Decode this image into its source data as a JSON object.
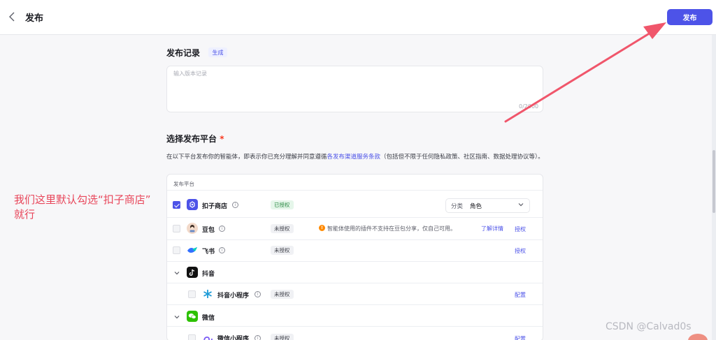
{
  "header": {
    "title": "发布",
    "publish_label": "发布"
  },
  "record": {
    "title": "发布记录",
    "generate_label": "生成",
    "placeholder": "输入版本记录",
    "char_count": "0/2000"
  },
  "platforms": {
    "title": "选择发布平台",
    "required_mark": "*",
    "agreement_prefix": "在以下平台发布你的智能体，即表示你已充分理解并同意遵循",
    "agreement_link": "各发布渠道服务条款",
    "agreement_suffix": "（包括但不限于任何隐私政策、社区指南、数据处理协议等）。",
    "table_header": "发布平台",
    "rows": [
      {
        "name": "扣子商店",
        "status": "已授权",
        "checked": true
      },
      {
        "name": "豆包",
        "status": "未授权",
        "checked": false,
        "warning": "智能体使用的插件不支持在豆包分享，仅自己可用。",
        "warning_link": "了解详情",
        "action": "授权"
      },
      {
        "name": "飞书",
        "status": "未授权",
        "checked": false,
        "action": "授权"
      },
      {
        "name": "抖音",
        "group": true
      },
      {
        "name": "抖音小程序",
        "status": "未授权",
        "checked": false,
        "action": "配置"
      },
      {
        "name": "微信",
        "group": true
      },
      {
        "name": "微信小程序",
        "status": "未授权",
        "checked": false,
        "action": "配置"
      }
    ],
    "category": {
      "label": "分类",
      "value": "角色"
    }
  },
  "annotation": {
    "line1": "我们这里默认勾选“扣子商店”",
    "line2": "就行"
  },
  "watermark": "CSDN @Calvad0s",
  "colors": {
    "accent": "#4d53e8",
    "annotation": "#e8465a",
    "authorized": "#2a8a44",
    "warning": "#ff8a00"
  }
}
